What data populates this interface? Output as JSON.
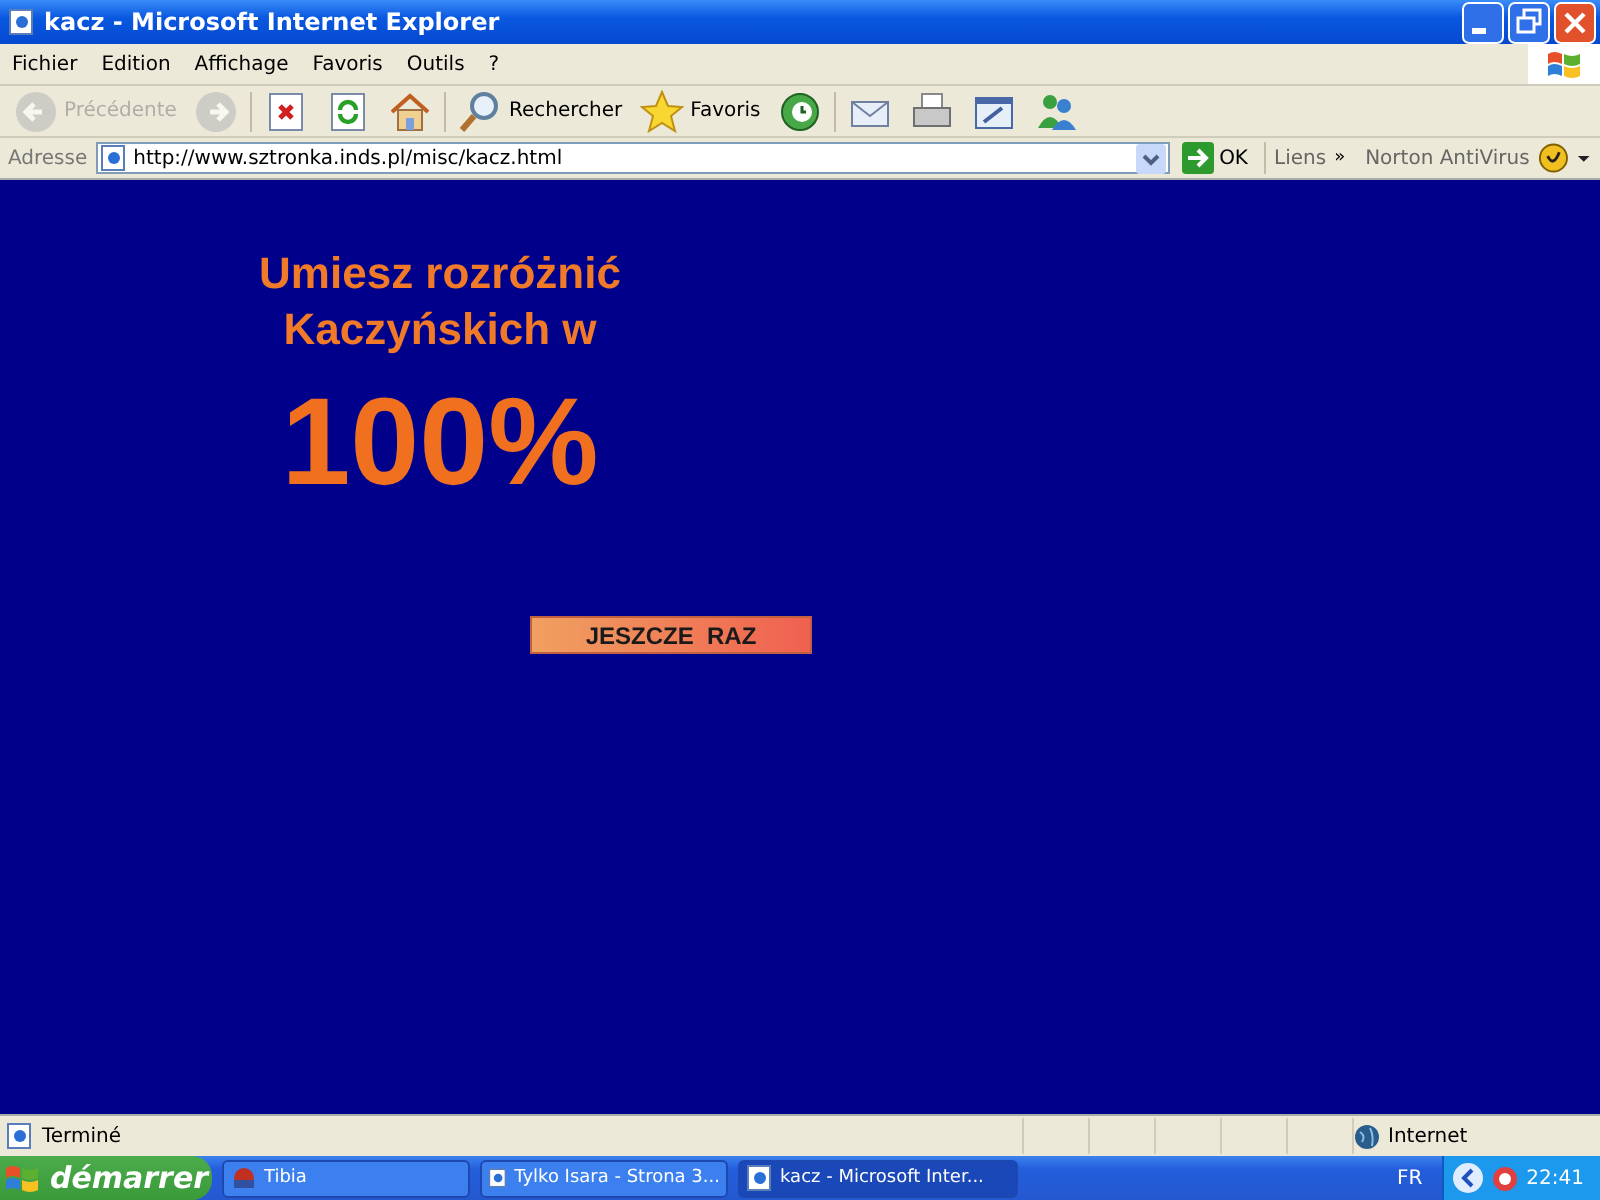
{
  "window": {
    "title": "kacz - Microsoft Internet Explorer"
  },
  "menu": [
    "Fichier",
    "Edition",
    "Affichage",
    "Favoris",
    "Outils",
    "?"
  ],
  "toolbar": [
    {
      "kind": "back",
      "label": "Précédente",
      "disabled": true
    },
    {
      "kind": "forward",
      "disabled": true
    },
    {
      "kind": "stop",
      "disabled": false
    },
    {
      "kind": "refresh",
      "disabled": false
    },
    {
      "kind": "home",
      "disabled": false
    },
    {
      "kind": "search",
      "label": "Rechercher",
      "disabled": false
    },
    {
      "kind": "favorites",
      "label": "Favoris",
      "disabled": false
    },
    {
      "kind": "history",
      "disabled": false
    },
    {
      "kind": "mail",
      "disabled": false
    },
    {
      "kind": "print",
      "disabled": false
    },
    {
      "kind": "edit",
      "disabled": false
    },
    {
      "kind": "messenger",
      "disabled": false
    }
  ],
  "address": {
    "label": "Adresse",
    "value": "http://www.sztronka.inds.pl/misc/kacz.html",
    "go": "OK",
    "links": "Liens",
    "links_more": "»",
    "plugin": "Norton AntiVirus"
  },
  "page": {
    "heading": [
      "Umiesz rozróżnić",
      "Kaczyńskich w"
    ],
    "score": "100%",
    "button": "JESZCZE  RAZ"
  },
  "status_bar": {
    "text": "Terminé",
    "zone": "Internet"
  },
  "taskbar": {
    "start": "démarrer",
    "tasks": [
      {
        "label": "Tibia",
        "selected": false
      },
      {
        "label": "Tylko Isara - Strona 3...",
        "selected": false
      },
      {
        "label": "kacz - Microsoft Inter...",
        "selected": true
      }
    ],
    "language": "FR",
    "clock": "22:41"
  }
}
